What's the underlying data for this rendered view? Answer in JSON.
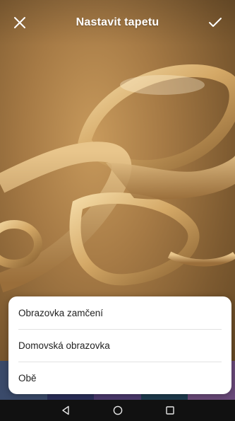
{
  "header": {
    "title": "Nastavit tapetu",
    "close_icon": "close-icon",
    "confirm_icon": "check-icon"
  },
  "sheet": {
    "options": [
      {
        "label": "Obrazovka zamčení"
      },
      {
        "label": "Domovská obrazovka"
      },
      {
        "label": "Obě"
      }
    ]
  },
  "navbar": {
    "back_icon": "back-triangle-icon",
    "home_icon": "home-circle-icon",
    "recents_icon": "recents-square-icon"
  },
  "colors": {
    "wallpaper_gold": "#b58a50",
    "sheet_bg": "#ffffff",
    "text": "#222222"
  }
}
